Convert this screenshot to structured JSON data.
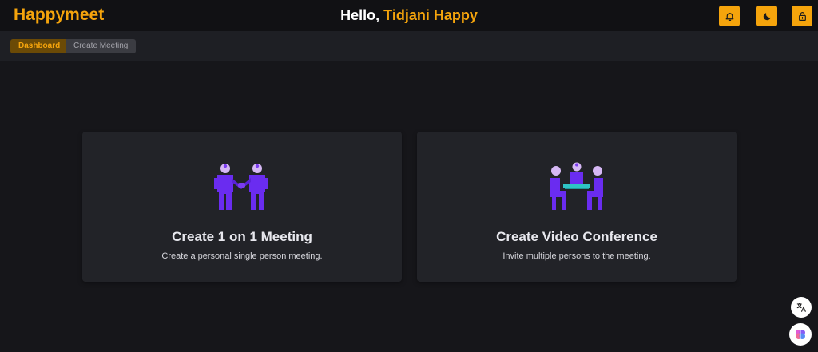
{
  "header": {
    "brand": "Happymeet",
    "greeting_prefix": "Hello, ",
    "user_name": "Tidjani Happy",
    "actions": [
      {
        "icon": "bell-icon"
      },
      {
        "icon": "moon-icon"
      },
      {
        "icon": "lock-icon"
      }
    ]
  },
  "breadcrumb": {
    "home": "Dashboard",
    "current": "Create Meeting"
  },
  "cards": [
    {
      "icon": "one-on-one-meeting-icon",
      "title": "Create 1 on 1 Meeting",
      "description": "Create a personal single person meeting."
    },
    {
      "icon": "video-conference-icon",
      "title": "Create Video Conference",
      "description": "Invite multiple persons to the meeting."
    }
  ],
  "floating": [
    {
      "icon": "translate-icon"
    },
    {
      "icon": "brain-icon"
    }
  ],
  "colors": {
    "accent": "#f5a40c",
    "background": "#16161a",
    "card": "#222328",
    "illustration_purple": "#6a2cf0",
    "illustration_head": "#d6b8f5",
    "illustration_teal": "#2ec4c4"
  }
}
